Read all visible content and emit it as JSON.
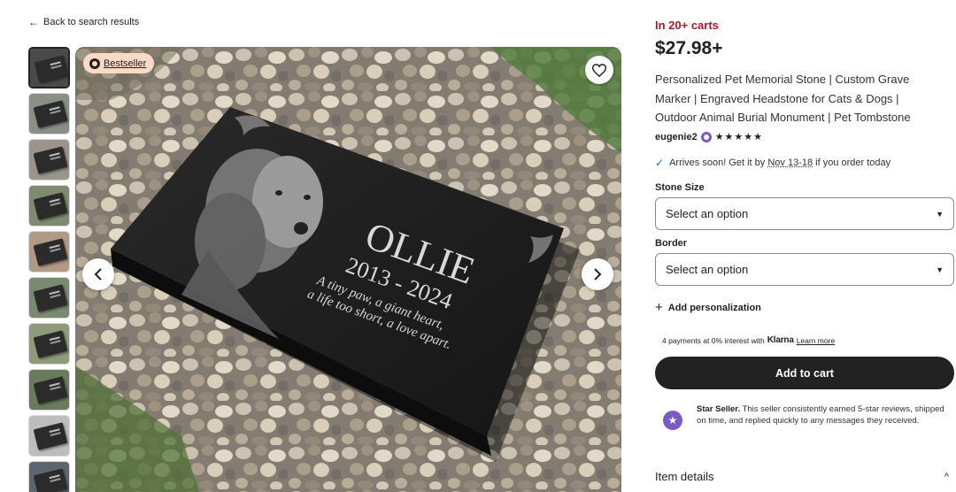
{
  "back_link": {
    "label": "Back to search results"
  },
  "gallery": {
    "badge": "Bestseller",
    "thumbnail_count": 10,
    "slab_text": {
      "name": "OLLIE",
      "years": "2013 - 2024",
      "line1": "A tiny paw, a giant heart,",
      "line2": "a life too short, a love apart."
    }
  },
  "product": {
    "in_carts": "In 20+ carts",
    "price": "$27.98+",
    "title": "Personalized Pet Memorial Stone | Custom Grave Marker | Engraved Headstone for Cats & Dogs | Outdoor Animal Burial Monument | Pet Tombstone",
    "seller": "eugenie2",
    "rating_stars": "★★★★★",
    "rating": 5
  },
  "shipping": {
    "prefix": "Arrives soon! Get it by",
    "date": "Nov 13-18",
    "suffix": "if you order today"
  },
  "options": {
    "stone_size": {
      "label": "Stone Size",
      "placeholder": "Select an option"
    },
    "border": {
      "label": "Border",
      "placeholder": "Select an option"
    }
  },
  "personalization": {
    "label": "Add personalization"
  },
  "payments": {
    "prefix": "4 payments at 0% interest with",
    "provider": "Klarna",
    "learn_more": "Learn more"
  },
  "cart": {
    "button_label": "Add to cart"
  },
  "star_seller": {
    "title": "Star Seller.",
    "text": "This seller consistently earned 5-star reviews, shipped on time, and replied quickly to any messages they received."
  },
  "item_details": {
    "label": "Item details"
  },
  "colors": {
    "accent_red": "#a61a2e",
    "star_seller_purple": "#7b5ac5",
    "bestseller_bg": "#fbd9c7",
    "check_blue": "#2f64b8"
  }
}
